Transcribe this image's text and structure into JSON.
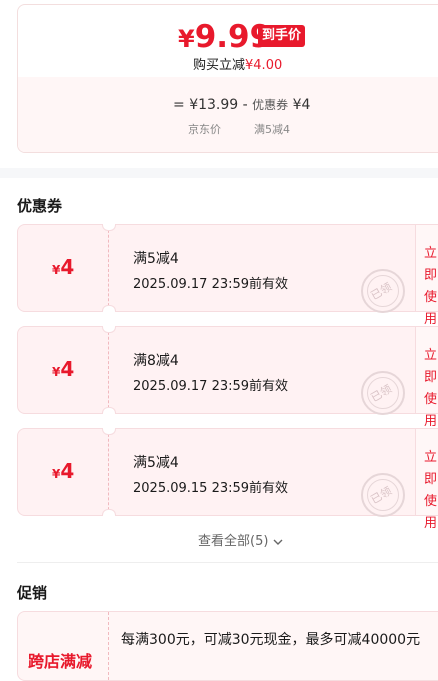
{
  "price": {
    "currency": "¥",
    "final": "9.99",
    "final_badge": "到手价",
    "saving_label": "购买立减",
    "saving_value": "¥4.00",
    "formula": {
      "equals": "=",
      "original": "¥13.99",
      "minus": "-",
      "coupon_label": "优惠券",
      "coupon_value": "¥4",
      "original_caption": "京东价",
      "coupon_caption": "满5减4"
    }
  },
  "coupons_section": {
    "title": "优惠券",
    "items": [
      {
        "currency": "¥",
        "amount": "4",
        "rule": "满5减4",
        "validity": "2025.09.17 23:59前有效",
        "stamp": "已领",
        "action": "立即使用"
      },
      {
        "currency": "¥",
        "amount": "4",
        "rule": "满8减4",
        "validity": "2025.09.17 23:59前有效",
        "stamp": "已领",
        "action": "立即使用"
      },
      {
        "currency": "¥",
        "amount": "4",
        "rule": "满5减4",
        "validity": "2025.09.15 23:59前有效",
        "stamp": "已领",
        "action": "立即使用"
      }
    ],
    "view_all": "查看全部(5)",
    "view_all_icon": "chevron-down-icon"
  },
  "promotion_section": {
    "title": "促销",
    "tag": "跨店满减",
    "description": "每满300元，可减30元现金，最多可减40000元"
  },
  "colors": {
    "accent": "#e8192c",
    "coupon_bg": "#fff2f3",
    "section_gap": "#f6f7f9"
  }
}
